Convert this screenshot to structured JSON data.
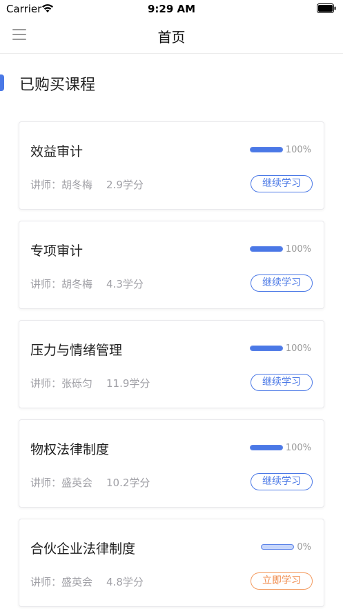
{
  "status_bar": {
    "carrier": "Carrier",
    "time": "9:29 AM"
  },
  "nav": {
    "title": "首页"
  },
  "section": {
    "title": "已购买课程"
  },
  "courses": [
    {
      "title": "效益审计",
      "teacher": "讲师：胡冬梅",
      "credits": "2.9学分",
      "progress": 1.0,
      "progress_text": "100%",
      "action": "继续学习",
      "action_type": "continue"
    },
    {
      "title": "专项审计",
      "teacher": "讲师：胡冬梅",
      "credits": "4.3学分",
      "progress": 1.0,
      "progress_text": "100%",
      "action": "继续学习",
      "action_type": "continue"
    },
    {
      "title": "压力与情绪管理",
      "teacher": "讲师：张砾匀",
      "credits": "11.9学分",
      "progress": 1.0,
      "progress_text": "100%",
      "action": "继续学习",
      "action_type": "continue"
    },
    {
      "title": "物权法律制度",
      "teacher": "讲师：盛英会",
      "credits": "10.2学分",
      "progress": 1.0,
      "progress_text": "100%",
      "action": "继续学习",
      "action_type": "continue"
    },
    {
      "title": "合伙企业法律制度",
      "teacher": "讲师：盛英会",
      "credits": "4.8学分",
      "progress": 0.0,
      "progress_text": "0%",
      "action": "立即学习",
      "action_type": "start"
    }
  ],
  "colors": {
    "accent": "#4a78e6",
    "start_accent": "#f08a4a"
  }
}
